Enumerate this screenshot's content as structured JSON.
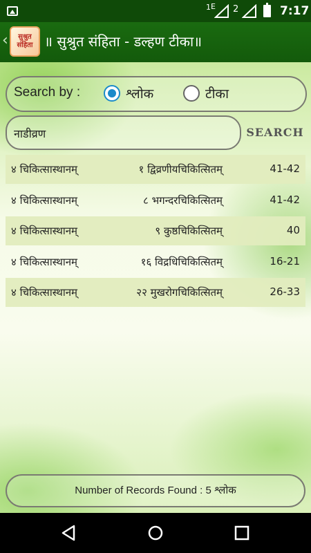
{
  "status_bar": {
    "time": "7:17",
    "sim1_label": "1",
    "sim1_network": "E",
    "sim2_label": "2",
    "icons": [
      "image-icon",
      "signal-sim1-icon",
      "signal-sim2-icon",
      "battery-icon"
    ]
  },
  "app_bar": {
    "logo_text": "सुश्रुत संहिता",
    "title": "॥ सुश्रुत संहिता - डल्हण टीका॥"
  },
  "search": {
    "label": "Search by :",
    "options": [
      {
        "label": "श्लोक",
        "selected": true
      },
      {
        "label": "टीका",
        "selected": false
      }
    ],
    "query": "नाडीव्रण",
    "button_label": "SEARCH"
  },
  "results": [
    {
      "section": "४ चिकित्सास्थानम्",
      "chapter": "१ द्विव्रणीयचिकित्सितम्",
      "verses": "41-42"
    },
    {
      "section": "४ चिकित्सास्थानम्",
      "chapter": "८ भगन्दरचिकित्सितम्",
      "verses": "41-42"
    },
    {
      "section": "४ चिकित्सास्थानम्",
      "chapter": "९ कुष्ठचिकित्सितम्",
      "verses": "40"
    },
    {
      "section": "४ चिकित्सास्थानम्",
      "chapter": "१६ विद्रधिचिकित्सितम्",
      "verses": "16-21"
    },
    {
      "section": "४ चिकित्सास्थानम्",
      "chapter": "२२ मुखरोगचिकित्सितम्",
      "verses": "26-33"
    }
  ],
  "footer": {
    "records_text": "Number of Records Found : 5 श्लोक"
  },
  "colors": {
    "app_bar": "#1a6b10",
    "status_bar": "#0f4a08",
    "radio_selected": "#1a8ac9",
    "row_shade": "#e2ecbe"
  }
}
